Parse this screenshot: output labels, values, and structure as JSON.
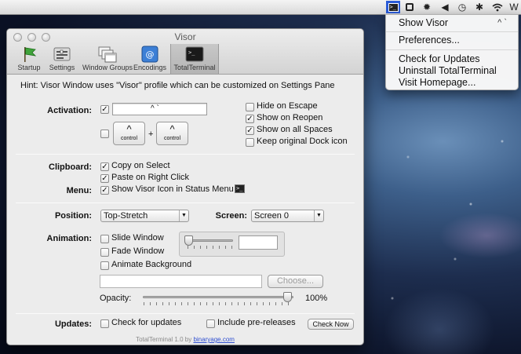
{
  "menubar": {
    "right_letter": "W"
  },
  "status_menu": {
    "items": [
      {
        "label": "Show Visor",
        "shortcut": "^ `"
      },
      {
        "label": "Preferences..."
      },
      {
        "label": "Check for Updates"
      },
      {
        "label": "Uninstall TotalTerminal"
      },
      {
        "label": "Visit Homepage..."
      }
    ]
  },
  "window": {
    "title": "Visor",
    "toolbar": [
      {
        "label": "Startup",
        "icon": "flag-icon"
      },
      {
        "label": "Settings",
        "icon": "settings-icon"
      },
      {
        "label": "Window Groups",
        "icon": "window-groups-icon"
      },
      {
        "label": "Encodings",
        "icon": "encodings-icon"
      },
      {
        "label": "TotalTerminal",
        "icon": "terminal-icon",
        "active": true
      }
    ],
    "hint": "Hint: Visor Window uses \"Visor\" profile which can be customized on Settings Pane",
    "activation": {
      "label": "Activation:",
      "hotkey": "^ `",
      "modifier_1": {
        "caret": "^",
        "label": "control"
      },
      "plus": "+",
      "modifier_2": {
        "caret": "^",
        "label": "control"
      },
      "options": [
        {
          "label": "Hide on Escape",
          "checked": false
        },
        {
          "label": "Show on Reopen",
          "checked": true
        },
        {
          "label": "Show on all Spaces",
          "checked": true
        },
        {
          "label": "Keep original Dock icon",
          "checked": false
        }
      ]
    },
    "clipboard": {
      "label": "Clipboard:",
      "options": [
        {
          "label": "Copy on Select",
          "checked": true
        },
        {
          "label": "Paste on Right Click",
          "checked": true
        }
      ]
    },
    "menu": {
      "label": "Menu:",
      "option": {
        "label": "Show Visor Icon in Status Menu",
        "checked": true
      }
    },
    "position": {
      "label": "Position:",
      "value": "Top-Stretch"
    },
    "screen": {
      "label": "Screen:",
      "value": "Screen 0"
    },
    "animation": {
      "label": "Animation:",
      "options": [
        {
          "label": "Slide Window",
          "checked": false
        },
        {
          "label": "Fade Window",
          "checked": false
        },
        {
          "label": "Animate Background",
          "checked": false
        }
      ],
      "choose_label": "Choose..."
    },
    "opacity": {
      "label": "Opacity:",
      "value": "100%",
      "fraction": 1.0
    },
    "updates": {
      "label": "Updates:",
      "check_label": "Check for updates",
      "prerelease_label": "Include pre-releases",
      "button_label": "Check Now"
    },
    "footer": {
      "text": "TotalTerminal 1.0 by",
      "link": "binaryage.com"
    }
  }
}
